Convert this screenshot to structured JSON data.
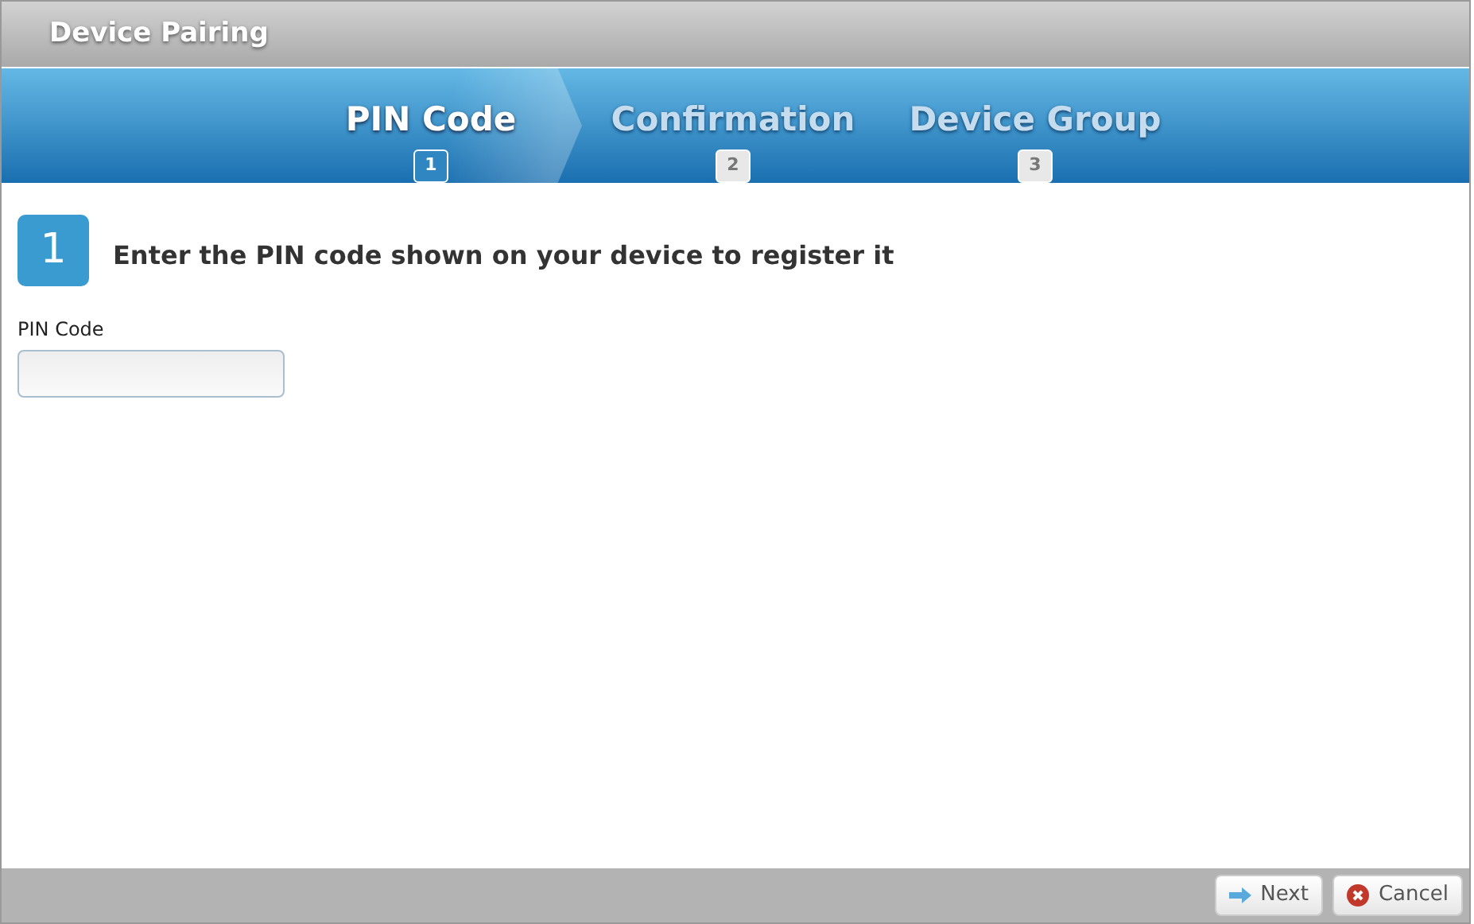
{
  "window": {
    "title": "Device Pairing"
  },
  "steps": [
    {
      "label": "PIN Code",
      "number": "1",
      "selected": true
    },
    {
      "label": "Confirmation",
      "number": "2",
      "selected": false
    },
    {
      "label": "Device Group",
      "number": "3",
      "selected": false
    }
  ],
  "section": {
    "number": "1",
    "heading": "Enter the PIN code shown on your device to register it"
  },
  "field": {
    "label": "PIN Code"
  },
  "buttons": [
    {
      "kind": "next",
      "label": "Next"
    },
    {
      "kind": "cancel",
      "label": "Cancel"
    }
  ]
}
